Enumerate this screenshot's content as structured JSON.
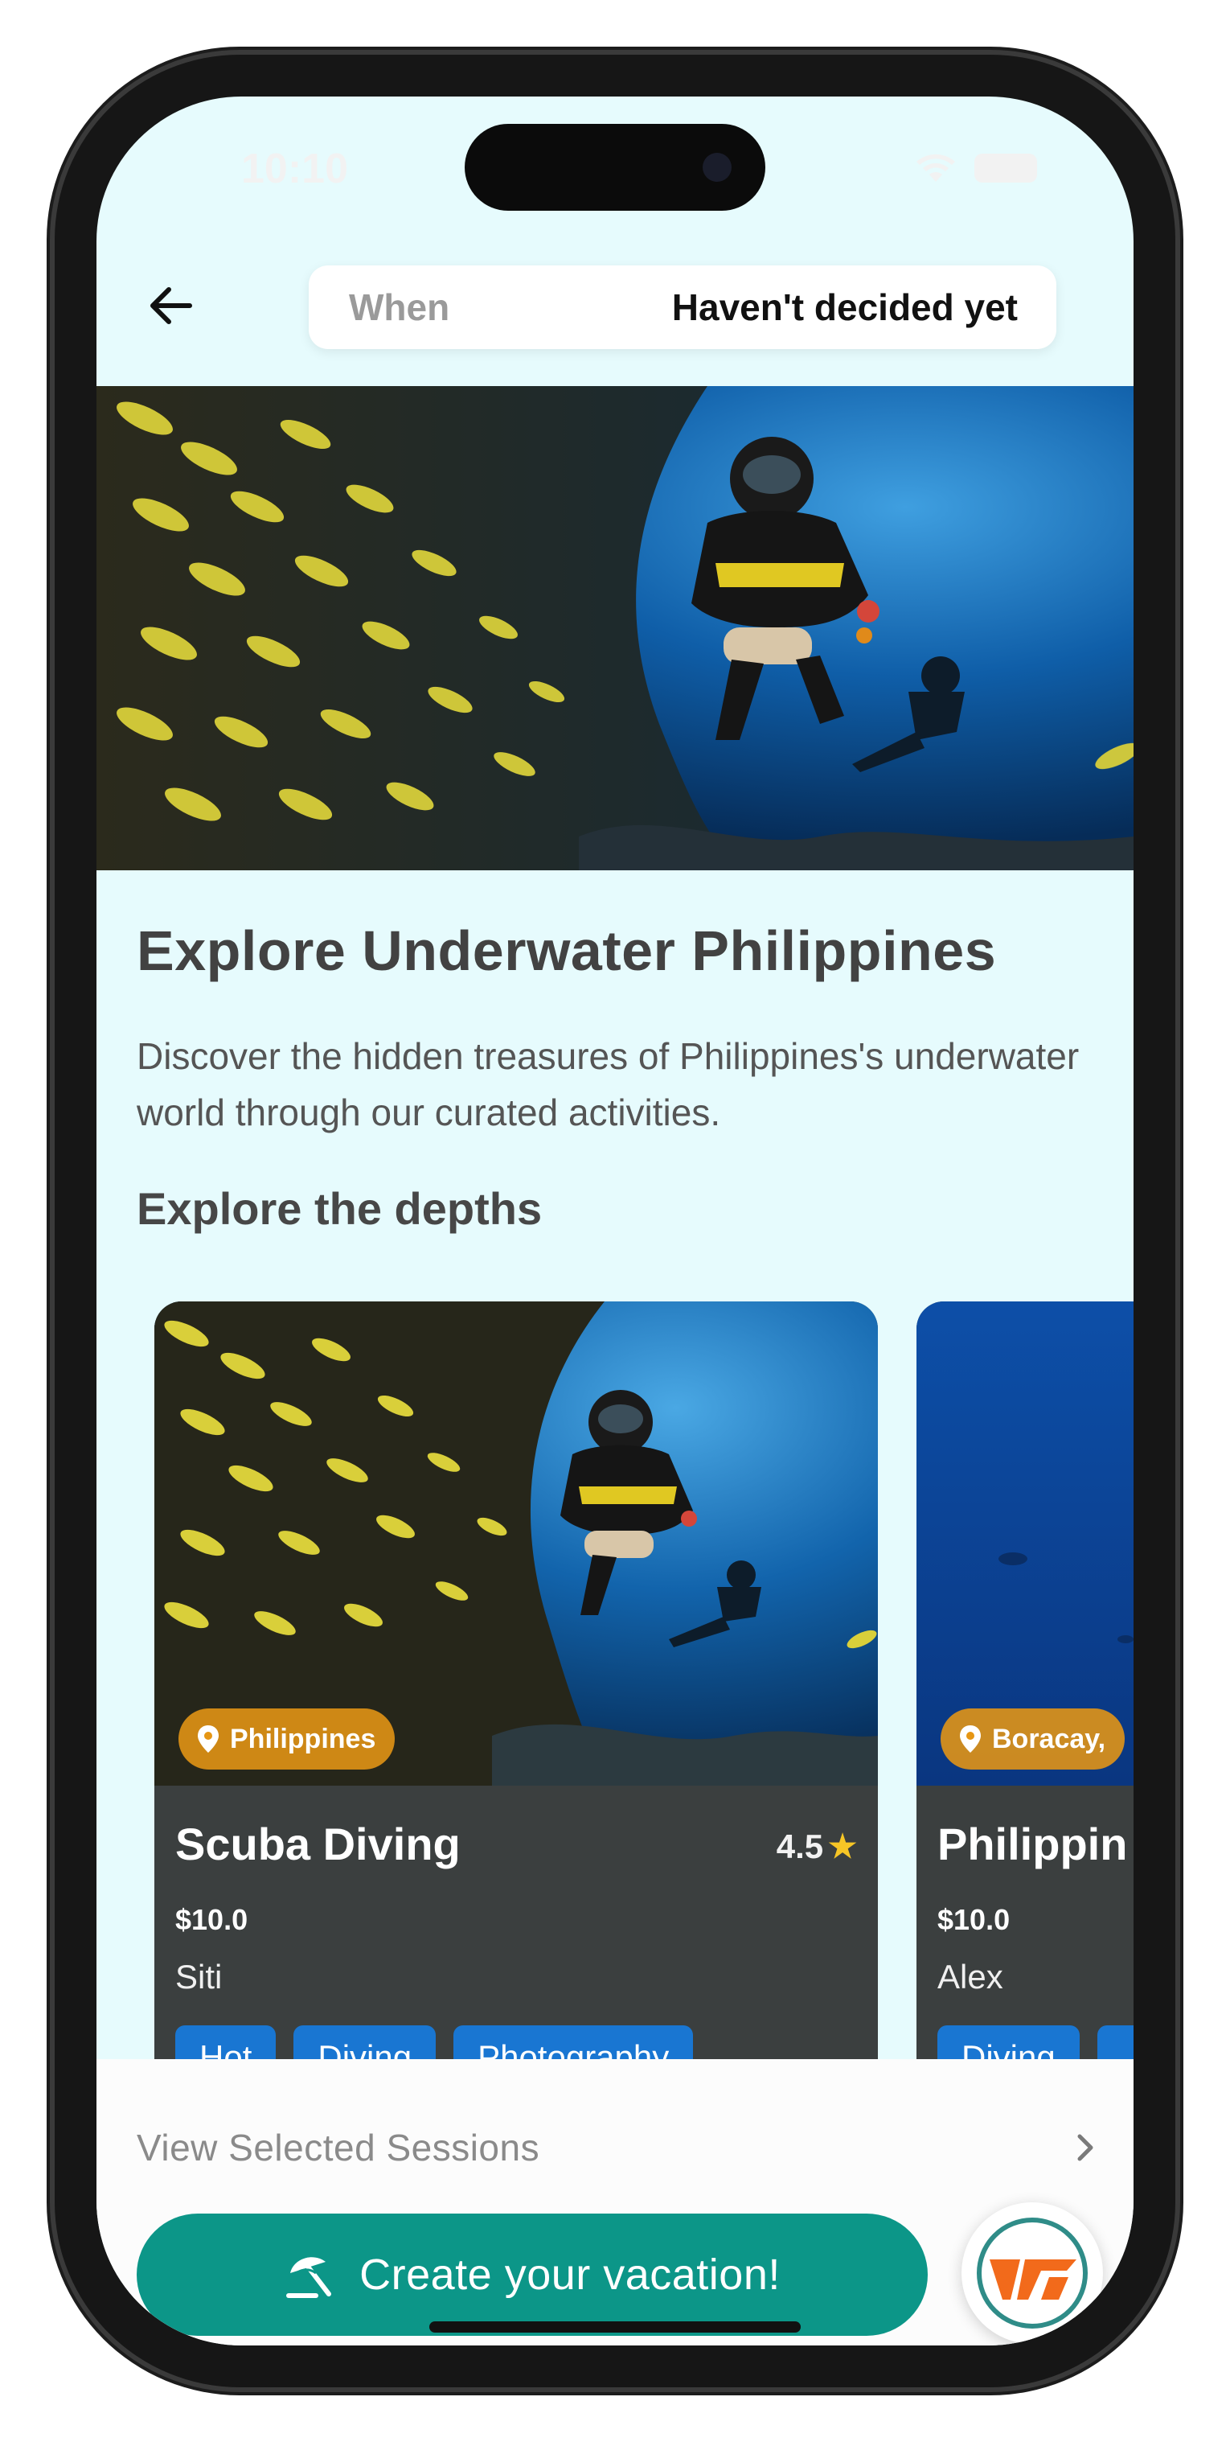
{
  "status_bar": {
    "time": "10:10"
  },
  "top_bar": {
    "when_label": "When",
    "when_value": "Haven't decided yet"
  },
  "hero": {
    "image_name": "scuba-diver-hero-image"
  },
  "content": {
    "title": "Explore Underwater Philippines",
    "description": "Discover the hidden treasures of Philippines's underwater world through our curated activities.",
    "section_title": "Explore the depths"
  },
  "cards": [
    {
      "location": "Philippines",
      "name": "Scuba Diving",
      "rating": "4.5",
      "price": "$10.0",
      "host": "Siti",
      "tags": [
        "Hot",
        "Diving",
        "Photography"
      ]
    },
    {
      "location": "Boracay,",
      "name": "Philippin",
      "price": "$10.0",
      "host": "Alex",
      "tags": [
        "Diving",
        ""
      ]
    }
  ],
  "bottom": {
    "view_sessions": "View Selected Sessions",
    "create_label": "Create your vacation!"
  },
  "colors": {
    "background": "#e6fbfd",
    "primary": "#0c9688",
    "tag": "#1976d2",
    "location_pill": "#e69614",
    "card": "#3b3f3f",
    "star": "#f7c626"
  }
}
